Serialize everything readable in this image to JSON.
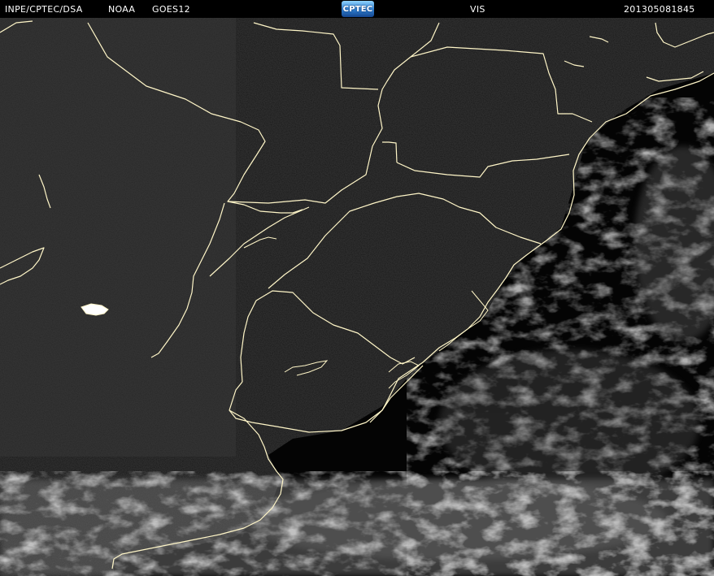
{
  "header": {
    "institution": "INPE/CPTEC/DSA",
    "agency": "NOAA",
    "satellite": "GOES12",
    "logo": "CPTEC",
    "channel": "VIS",
    "timestamp": "201305081845"
  },
  "colors": {
    "background": "#000000",
    "land": "#303030",
    "cloud": "#8a8a8a",
    "boundary": "#fff6c8",
    "ocean": "#050505"
  },
  "icons": {
    "logo": "cptec-logo"
  }
}
